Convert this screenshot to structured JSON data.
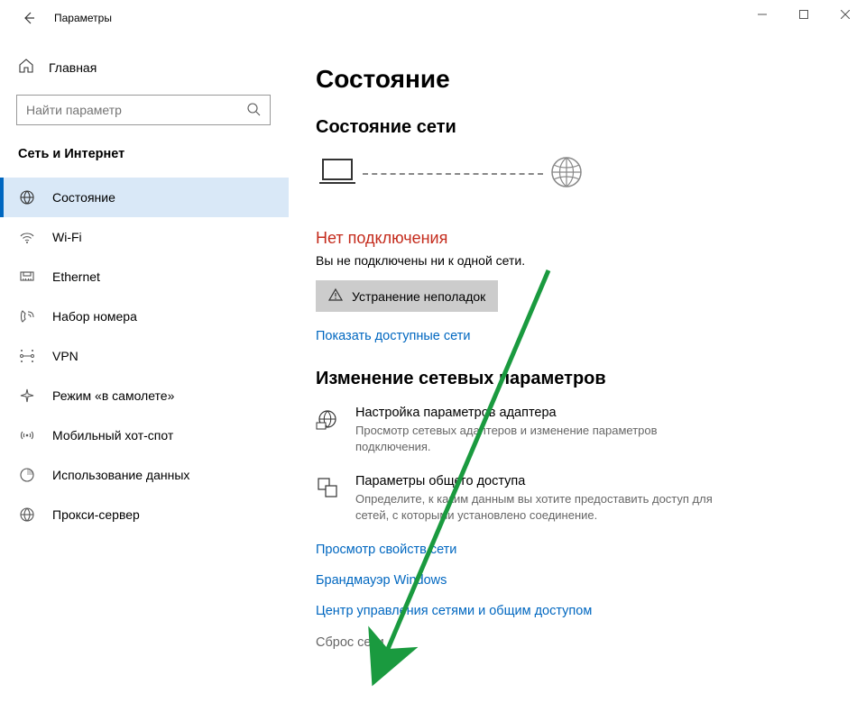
{
  "window": {
    "title": "Параметры"
  },
  "sidebar": {
    "home_label": "Главная",
    "search_placeholder": "Найти параметр",
    "category": "Сеть и Интернет",
    "items": [
      {
        "label": "Состояние"
      },
      {
        "label": "Wi-Fi"
      },
      {
        "label": "Ethernet"
      },
      {
        "label": "Набор номера"
      },
      {
        "label": "VPN"
      },
      {
        "label": "Режим «в самолете»"
      },
      {
        "label": "Мобильный хот-спот"
      },
      {
        "label": "Использование данных"
      },
      {
        "label": "Прокси-сервер"
      }
    ]
  },
  "main": {
    "page_title": "Состояние",
    "network_status_heading": "Состояние сети",
    "no_connection_title": "Нет подключения",
    "no_connection_sub": "Вы не подключены ни к одной сети.",
    "troubleshoot_label": "Устранение неполадок",
    "show_networks_link": "Показать доступные сети",
    "change_heading": "Изменение сетевых параметров",
    "adapter_title": "Настройка параметров адаптера",
    "adapter_desc": "Просмотр сетевых адаптеров и изменение параметров подключения.",
    "sharing_title": "Параметры общего доступа",
    "sharing_desc": "Определите, к каким данным вы хотите предоставить доступ для сетей, с которыми установлено соединение.",
    "view_props_link": "Просмотр свойств сети",
    "firewall_link": "Брандмауэр Windows",
    "control_center_link": "Центр управления сетями и общим доступом",
    "reset_link": "Сброс сети"
  }
}
